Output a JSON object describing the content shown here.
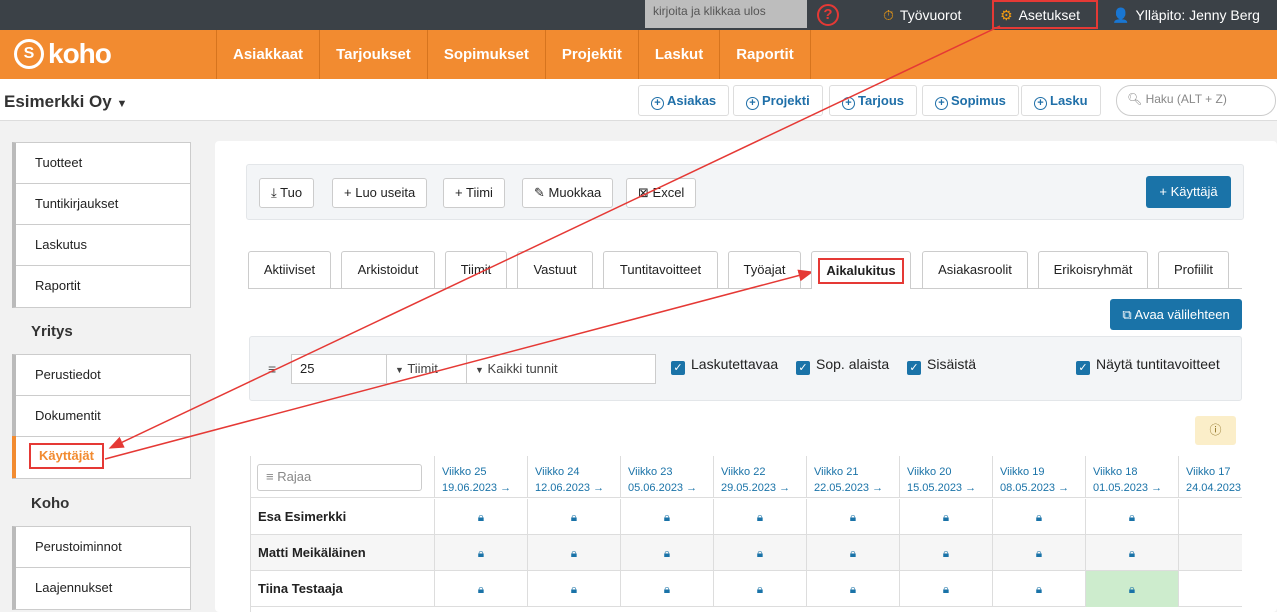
{
  "topbar": {
    "search_placeholder": "kirjoita ja klikkaa ulos",
    "help": "?",
    "shifts": "Työvuorot",
    "settings": "Asetukset",
    "admin": "Ylläpito: Jenny Berg"
  },
  "brand": {
    "mark": "S",
    "name": "koho"
  },
  "nav": [
    "Asiakkaat",
    "Tarjoukset",
    "Sopimukset",
    "Projektit",
    "Laskut",
    "Raportit"
  ],
  "company": "Esimerkki Oy",
  "quick": [
    "Asiakas",
    "Projekti",
    "Tarjous",
    "Sopimus",
    "Lasku"
  ],
  "global_search": "Haku (ALT + Z)",
  "sidebar": {
    "group1": [
      "Tuotteet",
      "Tuntikirjaukset",
      "Laskutus",
      "Raportit"
    ],
    "yritys_title": "Yritys",
    "group2": [
      "Perustiedot",
      "Dokumentit",
      "Käyttäjät"
    ],
    "koho_title": "Koho",
    "group3": [
      "Perustoiminnot",
      "Laajennukset"
    ]
  },
  "toolbar": {
    "import": "Tuo",
    "create_many": "Luo useita",
    "team": "Tiimi",
    "edit": "Muokkaa",
    "excel": "Excel",
    "add_user": "Käyttäjä"
  },
  "tabs": [
    "Aktiiviset",
    "Arkistoidut",
    "Tiimit",
    "Vastuut",
    "Tuntitavoitteet",
    "Työajat",
    "Aikalukitus",
    "Asiakasroolit",
    "Erikoisryhmät",
    "Profiilit"
  ],
  "open_tab": "Avaa välilehteen",
  "filters": {
    "page_size": "25",
    "team_select": "Tiimit",
    "hours_select": "Kaikki tunnit",
    "checks": [
      "Laskutettavaa",
      "Sop. alaista",
      "Sisäistä",
      "Näytä tuntitavoitteet"
    ]
  },
  "grid": {
    "filter_placeholder": "Rajaa",
    "weeks": [
      {
        "label": "Viikko 25",
        "date": "19.06.2023 →"
      },
      {
        "label": "Viikko 24",
        "date": "12.06.2023 →"
      },
      {
        "label": "Viikko 23",
        "date": "05.06.2023 →"
      },
      {
        "label": "Viikko 22",
        "date": "29.05.2023 →"
      },
      {
        "label": "Viikko 21",
        "date": "22.05.2023 →"
      },
      {
        "label": "Viikko 20",
        "date": "15.05.2023 →"
      },
      {
        "label": "Viikko 19",
        "date": "08.05.2023 →"
      },
      {
        "label": "Viikko 18",
        "date": "01.05.2023 →"
      },
      {
        "label": "Viikko 17",
        "date": "24.04.2023"
      }
    ],
    "rows": [
      "Esa Esimerkki",
      "Matti Meikäläinen",
      "Tiina Testaaja"
    ]
  },
  "colors": {
    "brand": "#f28b30",
    "primary": "#1a73a8",
    "highlight": "#e53935",
    "locked_green": "#cdeccd"
  }
}
